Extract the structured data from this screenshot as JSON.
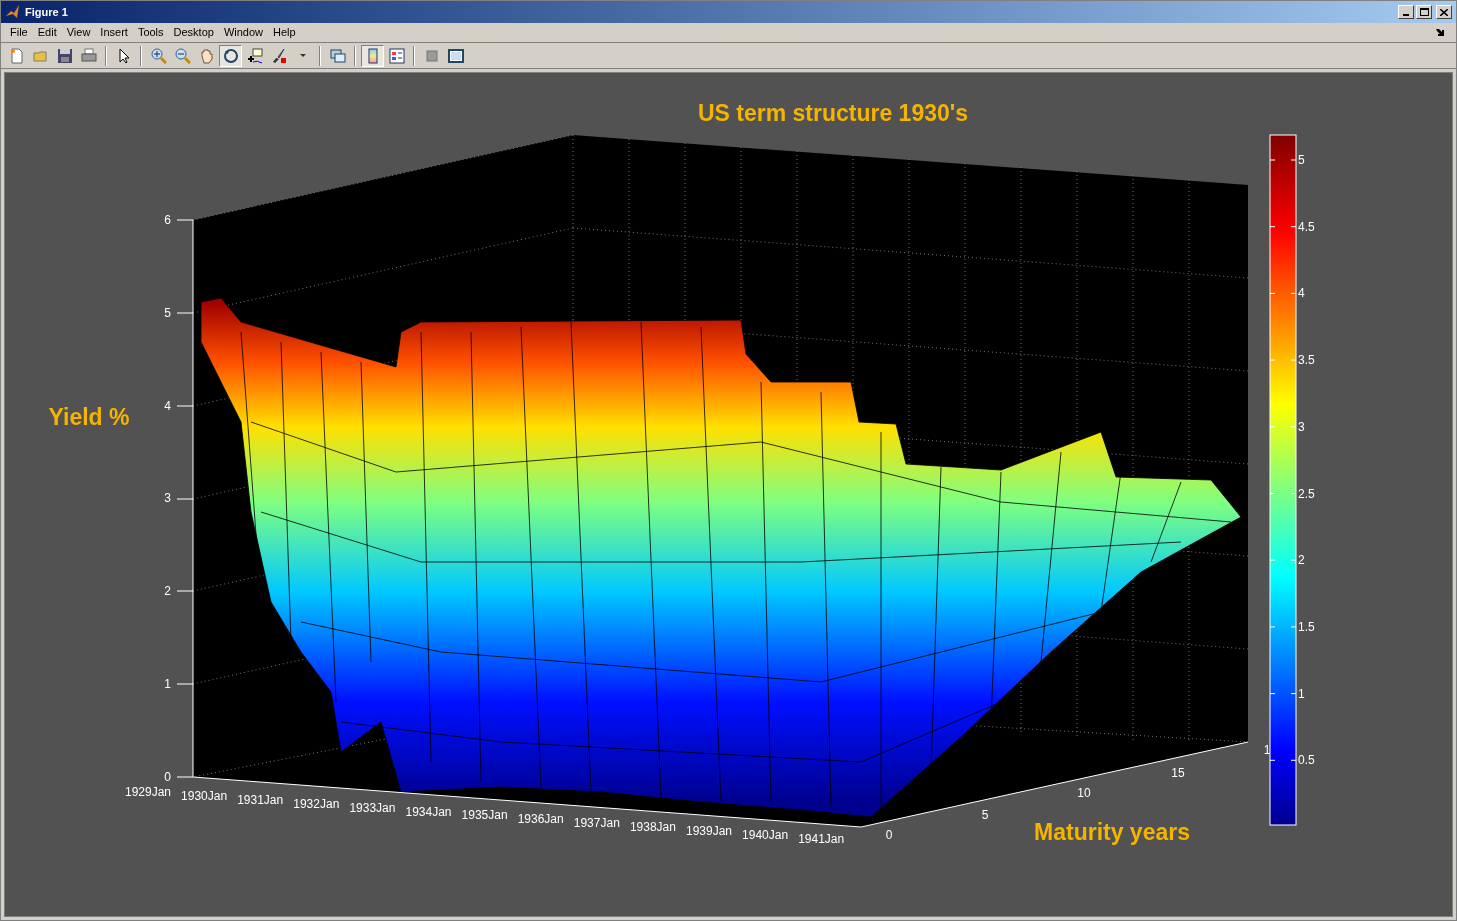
{
  "window": {
    "title": "Figure 1"
  },
  "menu": [
    "File",
    "Edit",
    "View",
    "Insert",
    "Tools",
    "Desktop",
    "Window",
    "Help"
  ],
  "toolbar": [
    {
      "kind": "new",
      "selected": false
    },
    {
      "kind": "open",
      "selected": false
    },
    {
      "kind": "save",
      "selected": false
    },
    {
      "kind": "print",
      "selected": false
    },
    {
      "kind": "sep"
    },
    {
      "kind": "pointer",
      "selected": false
    },
    {
      "kind": "sep"
    },
    {
      "kind": "zoomin",
      "selected": false
    },
    {
      "kind": "zoomout",
      "selected": false
    },
    {
      "kind": "pan",
      "selected": false
    },
    {
      "kind": "rotate",
      "selected": true
    },
    {
      "kind": "cursor",
      "selected": false
    },
    {
      "kind": "brush",
      "selected": false
    },
    {
      "kind": "caret",
      "selected": false
    },
    {
      "kind": "sep"
    },
    {
      "kind": "link",
      "selected": false
    },
    {
      "kind": "sep"
    },
    {
      "kind": "colorbar",
      "selected": true
    },
    {
      "kind": "legend",
      "selected": false
    },
    {
      "kind": "sep"
    },
    {
      "kind": "hide",
      "selected": false
    },
    {
      "kind": "dock",
      "selected": false
    }
  ],
  "plot": {
    "title": "US term structure 1930's",
    "zlabel": "Yield %",
    "ylabel": "Maturity years",
    "zticks": [
      "6",
      "5",
      "4",
      "3",
      "2",
      "1",
      "0"
    ],
    "xticks": [
      "1929Jan",
      "1930Jan",
      "1931Jan",
      "1932Jan",
      "1933Jan",
      "1934Jan",
      "1935Jan",
      "1936Jan",
      "1937Jan",
      "1938Jan",
      "1939Jan",
      "1940Jan",
      "1941Jan"
    ],
    "yticks": [
      "0",
      "5",
      "10",
      "15",
      "1"
    ],
    "colorbar_ticks": [
      "5",
      "4.5",
      "4",
      "3.5",
      "3",
      "2.5",
      "2",
      "1.5",
      "1",
      "0.5"
    ]
  }
}
